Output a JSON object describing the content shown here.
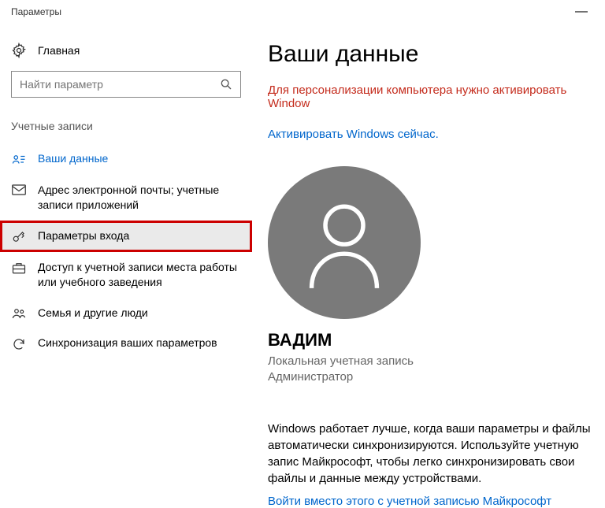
{
  "titlebar": {
    "title": "Параметры"
  },
  "sidebar": {
    "home": "Главная",
    "search_placeholder": "Найти параметр",
    "section": "Учетные записи",
    "items": [
      {
        "label": "Ваши данные",
        "active": true
      },
      {
        "label": "Адрес электронной почты; учетные записи приложений"
      },
      {
        "label": "Параметры входа",
        "selected": true
      },
      {
        "label": "Доступ к учетной записи места работы или учебного заведения"
      },
      {
        "label": "Семья и другие люди"
      },
      {
        "label": "Синхронизация ваших параметров"
      }
    ]
  },
  "content": {
    "heading": "Ваши данные",
    "warning": "Для персонализации компьютера нужно активировать Window",
    "activate": "Активировать Windows сейчас.",
    "username": "ВАДИМ",
    "account_type": "Локальная учетная запись",
    "account_role": "Администратор",
    "body": "Windows работает лучше, когда ваши параметры и файлы автоматически синхронизируются. Используйте учетную запис Майкрософт, чтобы легко синхронизировать свои файлы и данные между устройствами.",
    "signin": "Войти вместо этого с учетной записью Майкрософт"
  }
}
